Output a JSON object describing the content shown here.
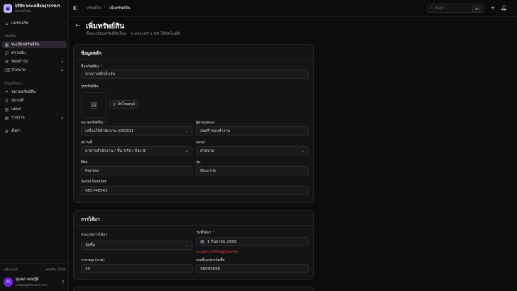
{
  "brand": {
    "name": "บริษัท พระเคลื่อนธุรกรรมฯ",
    "sub": "AssetFlow",
    "logo": "box-icon"
  },
  "sidebar": {
    "dashboard": "แดชบอร์ด",
    "group_assets": "ทรัพย์สิน",
    "items_assets": [
      {
        "label": "ทะเบียนทรัพย์สิน",
        "icon": "package-icon"
      },
      {
        "label": "ตรวจนับ",
        "icon": "clipboard-check-icon"
      },
      {
        "label": "ซ่อมบำรุง",
        "icon": "wrench-icon"
      },
      {
        "label": "จำหน่าย",
        "icon": "trash-icon"
      }
    ],
    "group_master": "ข้อมูลพื้นฐาน",
    "items_master": [
      {
        "label": "หมวดทรัพย์สิน",
        "icon": "tag-icon"
      },
      {
        "label": "สถานที่",
        "icon": "map-pin-icon"
      },
      {
        "label": "แผนก",
        "icon": "building-icon"
      },
      {
        "label": "รายงาน",
        "icon": "file-text-icon"
      }
    ],
    "settings": "ตั้งค่า",
    "lang_label": "แพ็กเกจฟรี",
    "lang_value": "ทรัพย์สิน 2/100",
    "user_initials": "จจ",
    "user_name": "จุมพล จอมรู้ดี",
    "user_email": "jumpol@thaiware.com"
  },
  "topbar": {
    "crumb1": "ทรัพย์สิน",
    "crumb2": "เพิ่มทรัพย์สิน",
    "search_placeholder": "ค้นหา...",
    "search_kbd": "⌘K"
  },
  "page": {
    "title": "เพิ่มทรัพย์สิน",
    "subtitle": "ขึ้นทะเบียนทรัพย์สินใหม่ - ระบบจะสร้าง QR ให้อัตโนมัติ"
  },
  "basic": {
    "title": "ข้อมูลหลัก",
    "name_label": "ชื่อทรัพย์สิน",
    "name_value": "ปากกาหมึกน้ำเงิน",
    "image_label": "รูปทรัพย์สิน",
    "upload_label": "อัปโหลดรูป",
    "category_label": "หมวดทรัพย์สิน",
    "category_value": "เครื่องใช้สำนักงาน (00002)",
    "custodian_label": "ผู้ครอบครอง",
    "custodian_value": "สมศรี ชอบทำงาน",
    "location_label": "สถานที่",
    "location_value": "อาคารสำนักงาน / ชั้น 578 / ห้อง B",
    "department_label": "แผนก",
    "department_value": "ฝ่ายขาย",
    "brand_label": "ยี่ห้อ",
    "brand_value": "Parrots",
    "model_label": "รุ่น",
    "model_value": "Blue Ink",
    "serial_label": "Serial Number",
    "serial_value": "985748541"
  },
  "acquire": {
    "title": "การได้มา",
    "method_label": "ประเภทการได้มา",
    "method_value": "จัดซื้อ",
    "date_label": "วันที่ได้มา",
    "date_value": "1 กันยายน 2569",
    "date_error": "ระบุเฉพาะวันที่ไม่อยู่ในอนาคต",
    "price_label": "ราคาทุน (บาท)",
    "price_value": "10",
    "doc_label": "เลขที่เอกสารจัดซื้อ",
    "doc_value": "96895698"
  }
}
